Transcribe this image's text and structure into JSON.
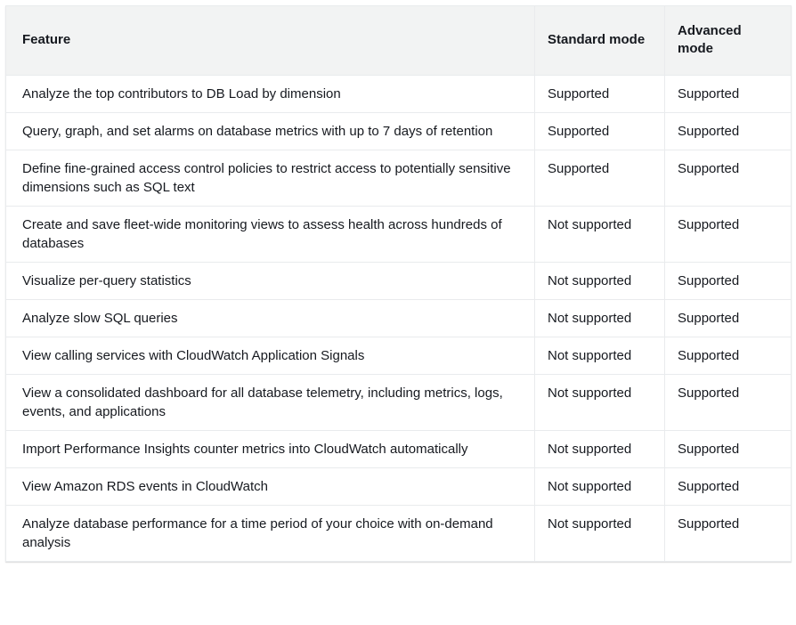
{
  "table": {
    "headers": {
      "feature": "Feature",
      "standard": "Standard mode",
      "advanced": "Advanced mode"
    },
    "rows": [
      {
        "feature": "Analyze the top contributors to DB Load by dimension",
        "standard": "Supported",
        "advanced": "Supported"
      },
      {
        "feature": "Query, graph, and set alarms on database metrics with up to 7 days of retention",
        "standard": "Supported",
        "advanced": "Supported"
      },
      {
        "feature": "Define fine-grained access control policies to restrict access to potentially sensitive dimensions such as SQL text",
        "standard": "Supported",
        "advanced": "Supported"
      },
      {
        "feature": "Create and save fleet-wide monitoring views to assess health across hundreds of databases",
        "standard": "Not supported",
        "advanced": "Supported"
      },
      {
        "feature": "Visualize per-query statistics",
        "standard": "Not supported",
        "advanced": "Supported"
      },
      {
        "feature": "Analyze slow SQL queries",
        "standard": "Not supported",
        "advanced": "Supported"
      },
      {
        "feature": "View calling services with CloudWatch Application Signals",
        "standard": "Not supported",
        "advanced": "Supported"
      },
      {
        "feature": "View a consolidated dashboard for all database telemetry, including metrics, logs, events, and applications",
        "standard": "Not supported",
        "advanced": "Supported"
      },
      {
        "feature": "Import Performance Insights counter metrics into CloudWatch automatically",
        "standard": "Not supported",
        "advanced": "Supported"
      },
      {
        "feature": "View Amazon RDS events in CloudWatch",
        "standard": "Not supported",
        "advanced": "Supported"
      },
      {
        "feature": "Analyze database performance for a time period of your choice with on-demand analysis",
        "standard": "Not supported",
        "advanced": "Supported"
      }
    ]
  }
}
